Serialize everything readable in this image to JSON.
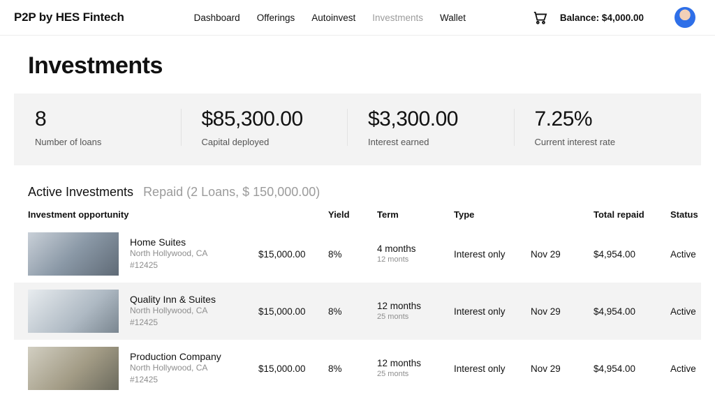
{
  "header": {
    "logo": "P2P by HES Fintech",
    "nav": [
      "Dashboard",
      "Offerings",
      "Autoinvest",
      "Investments",
      "Wallet"
    ],
    "nav_active_index": 3,
    "balance_label": "Balance: $4,000.00"
  },
  "page": {
    "title": "Investments"
  },
  "stats": [
    {
      "value": "8",
      "label": "Number of loans"
    },
    {
      "value": "$85,300.00",
      "label": "Capital deployed"
    },
    {
      "value": "$3,300.00",
      "label": "Interest earned"
    },
    {
      "value": "7.25%",
      "label": "Current interest rate"
    }
  ],
  "tabs": {
    "active": "Active Investments",
    "inactive": "Repaid (2 Loans, $ 150,000.00)"
  },
  "columns": {
    "opportunity": "Investment opportunity",
    "amount": "",
    "yield": "Yield",
    "term": "Term",
    "type": "Type",
    "date": "",
    "total_repaid": "Total repaid",
    "status": "Status"
  },
  "rows": [
    {
      "name": "Home Suites",
      "location": "North Hollywood, CA",
      "id": "#12425",
      "amount": "$15,000.00",
      "yield": "8%",
      "term": "4 months",
      "term_sub": "12 monts",
      "type": "Interest only",
      "date": "Nov 29",
      "total_repaid": "$4,954.00",
      "status": "Active",
      "highlight": false,
      "thumb_class": "t1"
    },
    {
      "name": "Quality Inn & Suites",
      "location": "North Hollywood, CA",
      "id": "#12425",
      "amount": "$15,000.00",
      "yield": "8%",
      "term": "12 months",
      "term_sub": "25 monts",
      "type": "Interest only",
      "date": "Nov 29",
      "total_repaid": "$4,954.00",
      "status": "Active",
      "highlight": true,
      "thumb_class": "t2"
    },
    {
      "name": "Production Company",
      "location": "North Hollywood, CA",
      "id": "#12425",
      "amount": "$15,000.00",
      "yield": "8%",
      "term": "12 months",
      "term_sub": "25 monts",
      "type": "Interest only",
      "date": "Nov 29",
      "total_repaid": "$4,954.00",
      "status": "Active",
      "highlight": false,
      "thumb_class": "t3"
    }
  ]
}
